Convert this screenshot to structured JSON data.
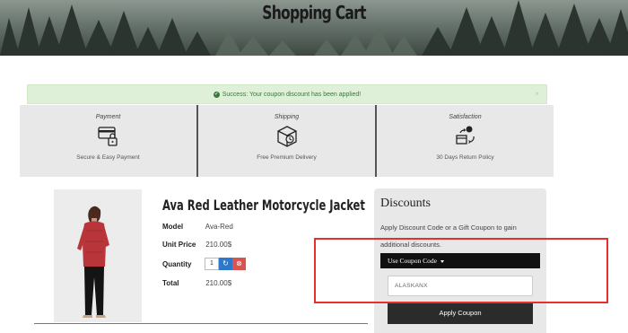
{
  "header": {
    "title": "Shopping Cart"
  },
  "alert": {
    "message": "Success: Your coupon discount has been applied!",
    "close": "×",
    "check": "✔"
  },
  "features": [
    {
      "title": "Payment",
      "icon": "credit-card-lock-icon",
      "description": "Secure & Easy Payment"
    },
    {
      "title": "Shipping",
      "icon": "delivery-box-icon",
      "description": "Free Premium Delivery"
    },
    {
      "title": "Satisfaction",
      "icon": "return-box-icon",
      "description": "30 Days Return Policy"
    }
  ],
  "product": {
    "name": "Ava Red Leather Motorcycle Jacket",
    "model_label": "Model",
    "model": "Ava-Red",
    "unit_price_label": "Unit Price",
    "unit_price": "210.00$",
    "quantity_label": "Quantity",
    "quantity": "1",
    "total_label": "Total",
    "total": "210.00$"
  },
  "discounts": {
    "title": "Discounts",
    "description": "Apply Discount Code or a Gift Coupon to gain additional discounts.",
    "toggle_label": "Use Coupon Code",
    "coupon_value": "ALASKANX",
    "apply_label": "Apply Coupon"
  },
  "colors": {
    "success_bg": "#dff0d8",
    "success_text": "#3c763d",
    "refresh_button": "#2e77c9",
    "remove_button": "#d9534f",
    "highlight": "#e53030"
  }
}
